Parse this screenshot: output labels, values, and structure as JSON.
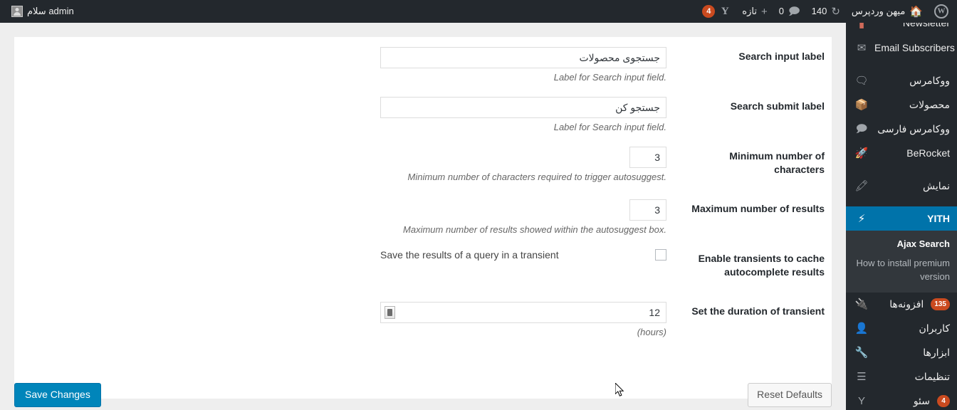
{
  "adminbar": {
    "wp_logo_icon": "wordpress-logo-icon",
    "site": {
      "icon": "home-icon",
      "label": "میهن وردپرس"
    },
    "updates": {
      "icon": "updates-icon",
      "count": "140"
    },
    "comments": {
      "icon": "comment-bubble-icon",
      "count": "0"
    },
    "new": {
      "icon": "plus-icon",
      "label": "تازه"
    },
    "yoast": {
      "icon": "yoast-icon",
      "badge": "4"
    },
    "howdy": {
      "avatar_icon": "user-avatar-icon",
      "label": "سلام admin"
    }
  },
  "sidebar": {
    "items": [
      {
        "label": "Newsletter",
        "icon": "newsletter-icon",
        "clipped": true
      },
      {
        "label": "Email Subscribers",
        "icon": "envelope-icon"
      },
      {
        "label": "ووکامرس",
        "icon": "woocommerce-icon"
      },
      {
        "label": "محصولات",
        "icon": "products-box-icon"
      },
      {
        "label": "ووکامرس فارسی",
        "icon": "woocommerce-persian-icon"
      },
      {
        "label": "BeRocket",
        "icon": "rocket-icon"
      },
      {
        "label": "نمایش",
        "icon": "appearance-brush-icon"
      },
      {
        "label": "YITH",
        "icon": "yith-icon",
        "current": true
      },
      {
        "label": "افزونه‌ها",
        "icon": "plugins-plug-icon",
        "badge": "135"
      },
      {
        "label": "کاربران",
        "icon": "users-icon"
      },
      {
        "label": "ابزارها",
        "icon": "tools-wrench-icon"
      },
      {
        "label": "تنظیمات",
        "icon": "settings-sliders-icon"
      },
      {
        "label": "سئو",
        "icon": "yoast-seo-icon",
        "badge": "4"
      }
    ],
    "submenu": [
      {
        "label": "Ajax Search",
        "current": true
      },
      {
        "label": "How to install premium version",
        "current": false
      }
    ]
  },
  "settings": {
    "rows": [
      {
        "label": "Search input label",
        "type": "text",
        "value": "جستجوی محصولات",
        "description": ".Label for Search input field"
      },
      {
        "label": "Search submit label",
        "type": "text",
        "value": "جستجو کن",
        "description": ".Label for Search input field"
      },
      {
        "label": "Minimum number of characters",
        "type": "number",
        "value": "3",
        "description": ".Minimum number of characters required to trigger autosuggest"
      },
      {
        "label": "Maximum number of results",
        "type": "number",
        "value": "3",
        "description": ".Maximum number of results showed within the autosuggest box"
      },
      {
        "label": "Enable transients to cache autocomplete results",
        "type": "checkbox",
        "checked": false,
        "checkbox_label": "Save the results of a query in a transient",
        "description": ""
      },
      {
        "label": "Set the duration of transient",
        "type": "number-wide",
        "value": "12",
        "description": "(hours)",
        "spinner_icon": "number-spinner-icon"
      }
    ]
  },
  "footer": {
    "save_label": "Save Changes",
    "reset_label": "Reset Defaults"
  },
  "colors": {
    "admin_bar": "#23282d",
    "sidebar": "#23282d",
    "submenu": "#32373c",
    "accent": "#0073aa",
    "primary_button": "#0085ba",
    "badge": "#ca4a1f",
    "page_bg": "#eeeeee"
  }
}
